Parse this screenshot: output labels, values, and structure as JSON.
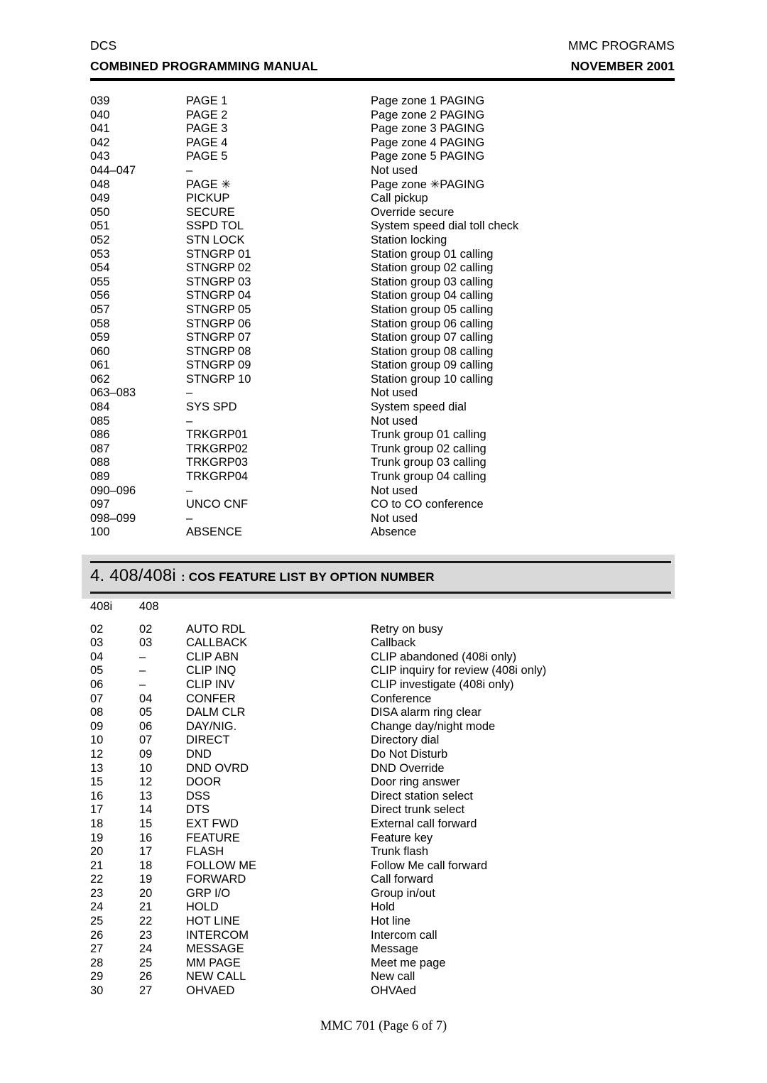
{
  "header": {
    "left_line1": "DCS",
    "left_line2": "COMBINED PROGRAMMING MANUAL",
    "right_line1": "MMC PROGRAMS",
    "right_line2": "NOVEMBER 2001"
  },
  "footer": {
    "text": "MMC 701 (Page 6 of 7)"
  },
  "section": {
    "number_title": "4. 408/408i",
    "subtitle": ": COS FEATURE LIST BY OPTION NUMBER",
    "band_color": "#d9d9d9"
  },
  "table1": {
    "columns": [
      "code",
      "name",
      "description"
    ],
    "rows": [
      {
        "code": "039",
        "name": "PAGE 1",
        "description": "Page zone 1 PAGING"
      },
      {
        "code": "040",
        "name": "PAGE 2",
        "description": "Page zone 2 PAGING"
      },
      {
        "code": "041",
        "name": "PAGE 3",
        "description": "Page zone 3 PAGING"
      },
      {
        "code": "042",
        "name": "PAGE 4",
        "description": "Page zone 4 PAGING"
      },
      {
        "code": "043",
        "name": "PAGE 5",
        "description": "Page zone 5 PAGING"
      },
      {
        "code": "044–047",
        "name": "–",
        "description": "Not used"
      },
      {
        "code": "048",
        "name": "PAGE ✳",
        "description": "Page zone ✳PAGING"
      },
      {
        "code": "049",
        "name": "PICKUP",
        "description": "Call pickup"
      },
      {
        "code": "050",
        "name": "SECURE",
        "description": "Override secure"
      },
      {
        "code": "051",
        "name": "SSPD TOL",
        "description": "System speed dial toll check"
      },
      {
        "code": "052",
        "name": "STN LOCK",
        "description": "Station locking"
      },
      {
        "code": "053",
        "name": "STNGRP 01",
        "description": "Station group 01 calling"
      },
      {
        "code": "054",
        "name": "STNGRP 02",
        "description": "Station group 02 calling"
      },
      {
        "code": "055",
        "name": "STNGRP 03",
        "description": "Station group 03 calling"
      },
      {
        "code": "056",
        "name": "STNGRP 04",
        "description": "Station group 04 calling"
      },
      {
        "code": "057",
        "name": "STNGRP 05",
        "description": "Station group 05 calling"
      },
      {
        "code": "058",
        "name": "STNGRP 06",
        "description": "Station group 06 calling"
      },
      {
        "code": "059",
        "name": "STNGRP 07",
        "description": "Station group 07 calling"
      },
      {
        "code": "060",
        "name": "STNGRP 08",
        "description": "Station group 08 calling"
      },
      {
        "code": "061",
        "name": "STNGRP 09",
        "description": "Station group 09 calling"
      },
      {
        "code": "062",
        "name": "STNGRP 10",
        "description": "Station group 10 calling"
      },
      {
        "code": "063–083",
        "name": "–",
        "description": "Not used"
      },
      {
        "code": "084",
        "name": "SYS SPD",
        "description": "System speed dial"
      },
      {
        "code": "085",
        "name": "–",
        "description": "Not used"
      },
      {
        "code": "086",
        "name": "TRKGRP01",
        "description": "Trunk group 01 calling"
      },
      {
        "code": "087",
        "name": "TRKGRP02",
        "description": "Trunk group 02 calling"
      },
      {
        "code": "088",
        "name": "TRKGRP03",
        "description": "Trunk group 03 calling"
      },
      {
        "code": "089",
        "name": "TRKGRP04",
        "description": "Trunk group 04 calling"
      },
      {
        "code": "090–096",
        "name": "–",
        "description": "Not used"
      },
      {
        "code": "097",
        "name": "UNCO CNF",
        "description": "CO to CO conference"
      },
      {
        "code": "098–099",
        "name": "–",
        "description": "Not used"
      },
      {
        "code": "100",
        "name": "ABSENCE",
        "description": "Absence"
      }
    ]
  },
  "table2": {
    "columns": [
      "408i",
      "408",
      "name",
      "description"
    ],
    "header_row": {
      "col_408i": "408i",
      "col_408": "408",
      "name": "",
      "description": ""
    },
    "rows": [
      {
        "col_408i": "02",
        "col_408": "02",
        "name": "AUTO RDL",
        "description": "Retry on busy"
      },
      {
        "col_408i": "03",
        "col_408": "03",
        "name": "CALLBACK",
        "description": "Callback"
      },
      {
        "col_408i": "04",
        "col_408": "–",
        "name": "CLIP ABN",
        "description": "CLIP abandoned (408i only)"
      },
      {
        "col_408i": "05",
        "col_408": "–",
        "name": "CLIP INQ",
        "description": "CLIP inquiry for review (408i only)"
      },
      {
        "col_408i": "06",
        "col_408": "–",
        "name": "CLIP INV",
        "description": "CLIP investigate (408i only)"
      },
      {
        "col_408i": "07",
        "col_408": "04",
        "name": "CONFER",
        "description": "Conference"
      },
      {
        "col_408i": "08",
        "col_408": "05",
        "name": "DALM CLR",
        "description": "DISA alarm ring clear"
      },
      {
        "col_408i": "09",
        "col_408": "06",
        "name": "DAY/NIG.",
        "description": "Change day/night mode"
      },
      {
        "col_408i": "10",
        "col_408": "07",
        "name": "DIRECT",
        "description": "Directory dial"
      },
      {
        "col_408i": "12",
        "col_408": "09",
        "name": "DND",
        "description": "Do Not Disturb"
      },
      {
        "col_408i": "13",
        "col_408": "10",
        "name": "DND OVRD",
        "description": "DND Override"
      },
      {
        "col_408i": "15",
        "col_408": "12",
        "name": "DOOR",
        "description": "Door ring answer"
      },
      {
        "col_408i": "16",
        "col_408": "13",
        "name": "DSS",
        "description": "Direct station select"
      },
      {
        "col_408i": "17",
        "col_408": "14",
        "name": "DTS",
        "description": "Direct trunk select"
      },
      {
        "col_408i": "18",
        "col_408": "15",
        "name": "EXT FWD",
        "description": "External call forward"
      },
      {
        "col_408i": "19",
        "col_408": "16",
        "name": "FEATURE",
        "description": "Feature key"
      },
      {
        "col_408i": "20",
        "col_408": "17",
        "name": "FLASH",
        "description": "Trunk flash"
      },
      {
        "col_408i": "21",
        "col_408": "18",
        "name": "FOLLOW ME",
        "description": "Follow Me call forward"
      },
      {
        "col_408i": "22",
        "col_408": "19",
        "name": "FORWARD",
        "description": "Call forward"
      },
      {
        "col_408i": "23",
        "col_408": "20",
        "name": "GRP I/O",
        "description": "Group in/out"
      },
      {
        "col_408i": "24",
        "col_408": "21",
        "name": "HOLD",
        "description": "Hold"
      },
      {
        "col_408i": "25",
        "col_408": "22",
        "name": "HOT LINE",
        "description": "Hot line"
      },
      {
        "col_408i": "26",
        "col_408": "23",
        "name": "INTERCOM",
        "description": "Intercom call"
      },
      {
        "col_408i": "27",
        "col_408": "24",
        "name": "MESSAGE",
        "description": "Message"
      },
      {
        "col_408i": "28",
        "col_408": "25",
        "name": "MM PAGE",
        "description": "Meet me page"
      },
      {
        "col_408i": "29",
        "col_408": "26",
        "name": "NEW CALL",
        "description": "New call"
      },
      {
        "col_408i": "30",
        "col_408": "27",
        "name": "OHVAED",
        "description": "OHVAed"
      }
    ]
  }
}
